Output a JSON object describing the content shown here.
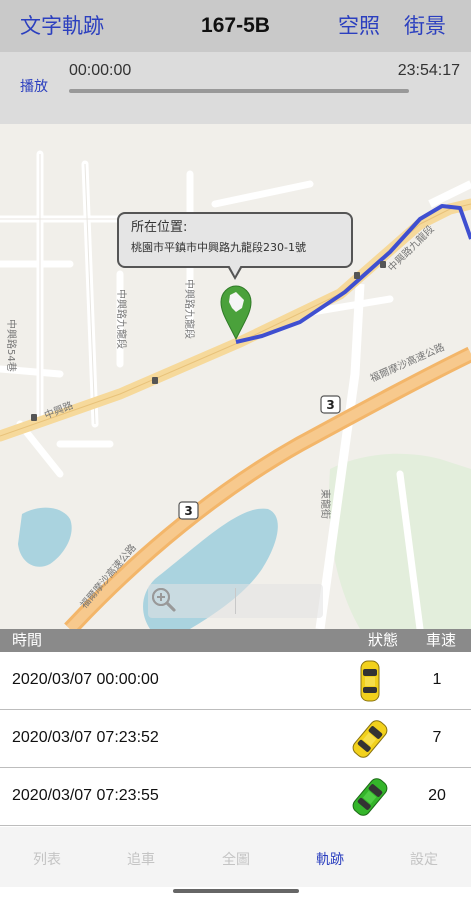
{
  "header": {
    "left_label": "文字軌跡",
    "title": "167-5B",
    "right1_label": "空照",
    "right2_label": "街景"
  },
  "playback": {
    "play_label": "播放",
    "start_time": "00:00:00",
    "end_time": "23:54:17"
  },
  "map": {
    "callout_label": "所在位置:",
    "callout_address": "桃園市平鎮市中興路九龍段230-1號",
    "road_labels": [
      "中興路54巷",
      "中興路九龍段",
      "中興路",
      "福爾摩沙高速公路",
      "3",
      "3",
      "東龍街"
    ],
    "route_color": "#3f4fd0",
    "marker_color": "#4aa13b"
  },
  "table": {
    "headers": {
      "time": "時間",
      "status": "狀態",
      "speed": "車速"
    },
    "rows": [
      {
        "time": "2020/03/07 00:00:00",
        "status_icon": "yellow-car-icon",
        "status_color": "#f2d11c",
        "speed": "1"
      },
      {
        "time": "2020/03/07 07:23:52",
        "status_icon": "yellow-car-icon",
        "status_color": "#f2d11c",
        "speed": "7"
      },
      {
        "time": "2020/03/07 07:23:55",
        "status_icon": "green-car-icon",
        "status_color": "#34b52a",
        "speed": "20"
      }
    ]
  },
  "tabs": [
    {
      "label": "列表",
      "active": false
    },
    {
      "label": "追車",
      "active": false
    },
    {
      "label": "全圖",
      "active": false
    },
    {
      "label": "軌跡",
      "active": true
    },
    {
      "label": "設定",
      "active": false
    }
  ]
}
